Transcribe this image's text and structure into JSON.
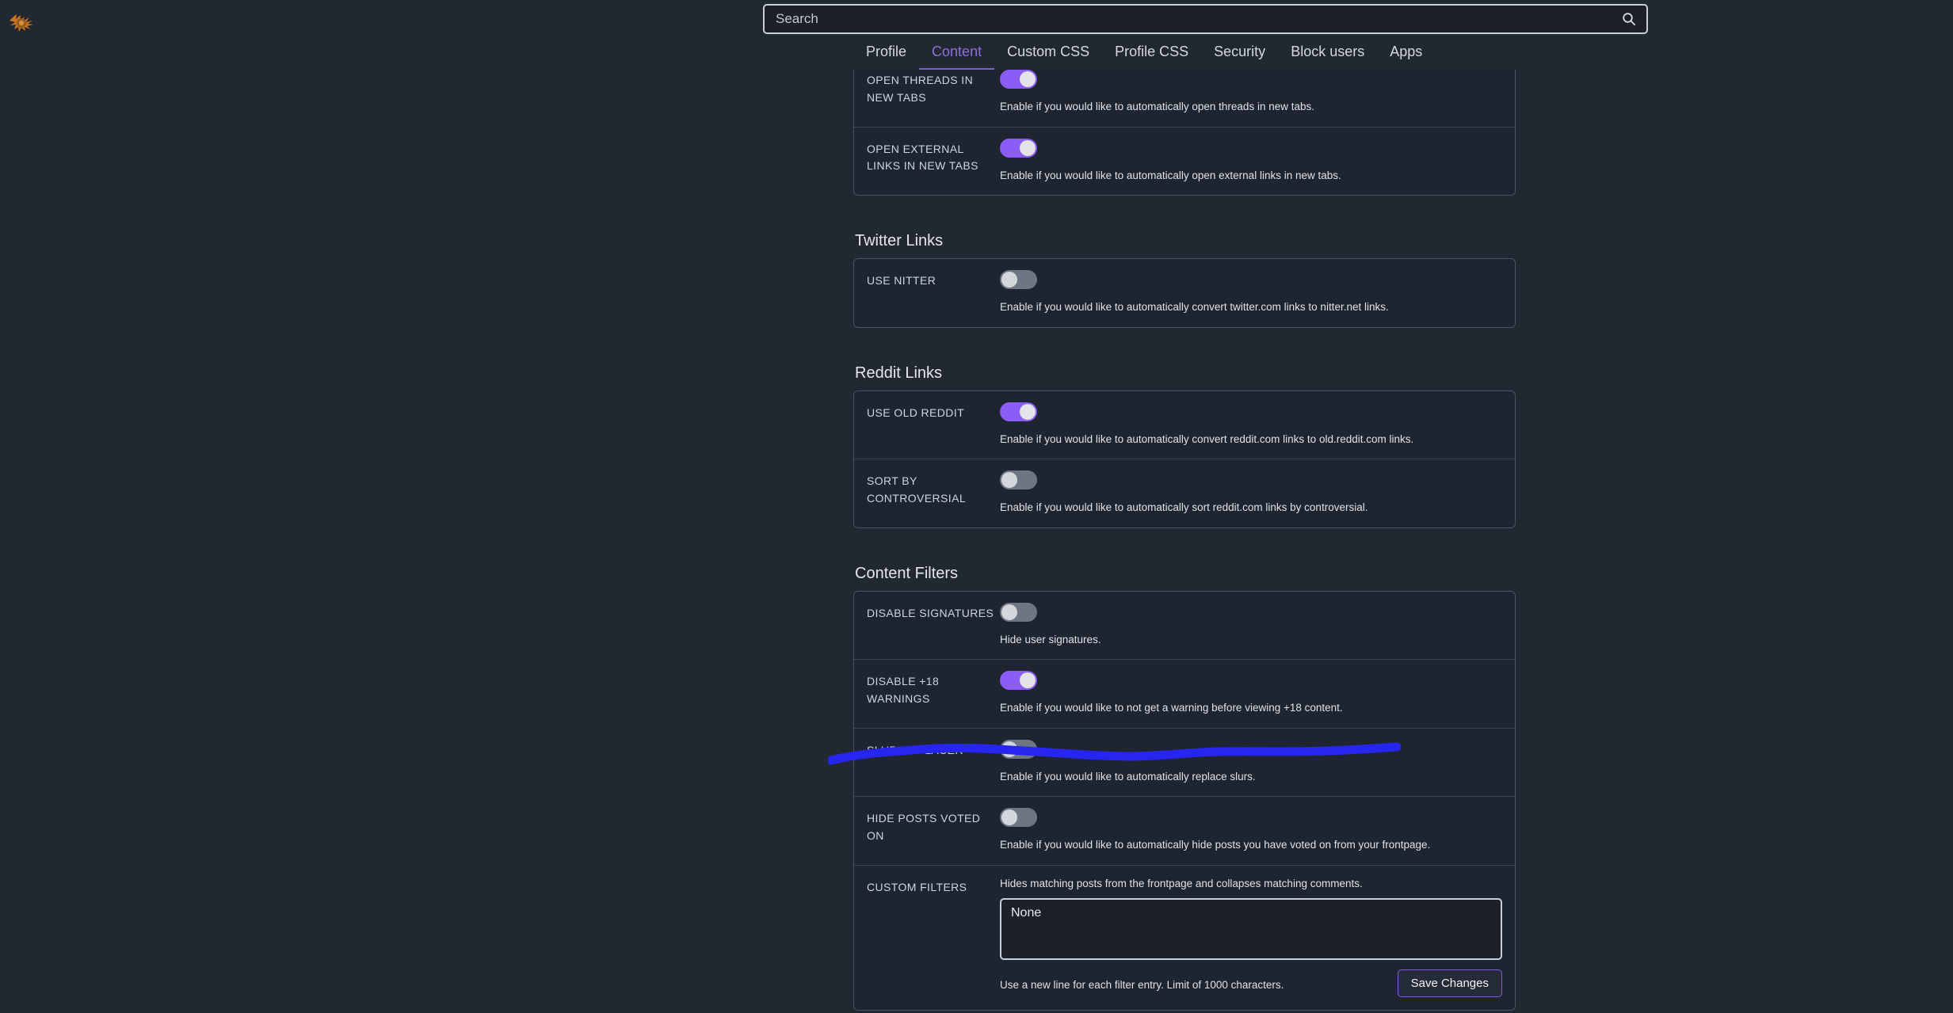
{
  "theme": {
    "page_bg": "#222831",
    "panel_bg": "#1e2530",
    "accent_purple": "#8b5cf6",
    "tab_active": "#8b6ee0",
    "toggle_off": "#6e7683",
    "annotation_blue": "#2726f0"
  },
  "topbar": {
    "logo_name": "site-logo-icon",
    "search": {
      "value": "",
      "placeholder": "Search",
      "icon": "search-icon"
    }
  },
  "tabs": [
    {
      "label": "Profile",
      "active": false
    },
    {
      "label": "Content",
      "active": true
    },
    {
      "label": "Custom CSS",
      "active": false
    },
    {
      "label": "Profile CSS",
      "active": false
    },
    {
      "label": "Security",
      "active": false
    },
    {
      "label": "Block users",
      "active": false
    },
    {
      "label": "Apps",
      "active": false
    }
  ],
  "sections": [
    {
      "id": "links-top",
      "title": "",
      "clipped_top": true,
      "rows": [
        {
          "label": "Open Threads In New Tabs",
          "label_display": "OPEN THREADS IN NEW TABS",
          "toggle": "on",
          "desc": "Enable if you would like to automatically open threads in new tabs."
        },
        {
          "label": "Open External Links In New Tabs",
          "label_display": "OPEN EXTERNAL LINKS IN NEW TABS",
          "toggle": "on",
          "desc": "Enable if you would like to automatically open external links in new tabs."
        }
      ]
    },
    {
      "id": "twitter-links",
      "title": "Twitter Links",
      "clipped_top": false,
      "rows": [
        {
          "label": "Use Nitter",
          "label_display": "USE NITTER",
          "toggle": "off",
          "desc": "Enable if you would like to automatically convert twitter.com links to nitter.net links."
        }
      ]
    },
    {
      "id": "reddit-links",
      "title": "Reddit Links",
      "clipped_top": false,
      "rows": [
        {
          "label": "Use Old Reddit",
          "label_display": "USE OLD REDDIT",
          "toggle": "on",
          "desc": "Enable if you would like to automatically convert reddit.com links to old.reddit.com links."
        },
        {
          "label": "Sort By Controversial",
          "label_display": "SORT BY CONTROVERSIAL",
          "toggle": "off",
          "desc": "Enable if you would like to automatically sort reddit.com links by controversial."
        }
      ]
    },
    {
      "id": "content-filters",
      "title": "Content Filters",
      "clipped_top": false,
      "rows": [
        {
          "label": "Disable Signatures",
          "label_display": "DISABLE SIGNATURES",
          "toggle": "off",
          "desc": "Hide user signatures."
        },
        {
          "label": "Disable +18 Warnings",
          "label_display": "DISABLE +18 WARNINGS",
          "toggle": "on",
          "desc": "Enable if you would like to not get a warning before viewing +18 content."
        },
        {
          "label": "Slur Replacer",
          "label_display": "SLUR REPLACER",
          "toggle": "off",
          "desc": "Enable if you would like to automatically replace slurs."
        },
        {
          "label": "Hide Posts Voted On",
          "label_display": "HIDE POSTS VOTED ON",
          "toggle": "off",
          "desc": "Enable if you would like to automatically hide posts you have voted on from your frontpage."
        }
      ]
    }
  ],
  "custom_filters": {
    "label_display": "CUSTOM FILTERS",
    "desc": "Hides matching posts from the frontpage and collapses matching comments.",
    "textarea_value": "None",
    "textarea_placeholder": "",
    "hint": "Use a new line for each filter entry. Limit of 1000 characters.",
    "save_label": "Save Changes"
  },
  "annotation": {
    "name": "blue-highlight-stroke",
    "color": "#2726f0"
  }
}
